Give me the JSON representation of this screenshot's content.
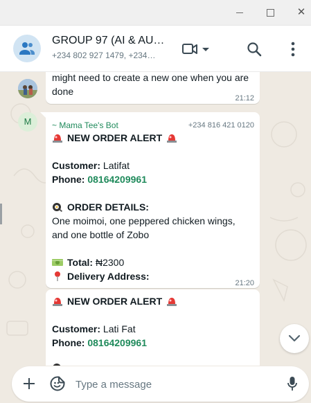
{
  "window": {
    "controls": [
      "minimize",
      "maximize",
      "close"
    ],
    "close_glyph": "✕"
  },
  "header": {
    "title": "GROUP 97 (AI & AUT…",
    "subtitle": "+234 802 927 1479, +234…",
    "icons": [
      "group-icon",
      "video-call-icon",
      "search-icon",
      "menu-dots-icon"
    ]
  },
  "messages": [
    {
      "lines": [
        "might need to create a new one when you are",
        "done"
      ],
      "time": "21:12"
    },
    {
      "avatar_letter": "M",
      "sender": "~ Mama Tee's Bot",
      "sender_phone": "+234 816 421 0120",
      "alert_title": "NEW ORDER ALERT",
      "customer_label": "Customer:",
      "customer_value": "Latifat",
      "phone_label": "Phone:",
      "phone_value": "08164209961",
      "details_title": "ORDER DETAILS:",
      "details_lines": [
        "One moimoi, one peppered chicken wings,",
        "and one bottle of Zobo"
      ],
      "total_label": "Total:",
      "total_value": "₦2300",
      "delivery_label": "Delivery Address:",
      "time": "21:20"
    },
    {
      "alert_title": "NEW ORDER ALERT",
      "customer_label": "Customer:",
      "customer_value": "Lati Fat",
      "phone_label": "Phone:",
      "phone_value": "08164209961"
    }
  ],
  "composer": {
    "placeholder": "Type a message",
    "icons": [
      "plus-icon",
      "sticker-icon",
      "mic-icon"
    ]
  },
  "colors": {
    "chat_background": "#efeae2",
    "bubble": "#ffffff",
    "accent_green": "#1f8a5b",
    "muted_text": "#667781"
  }
}
